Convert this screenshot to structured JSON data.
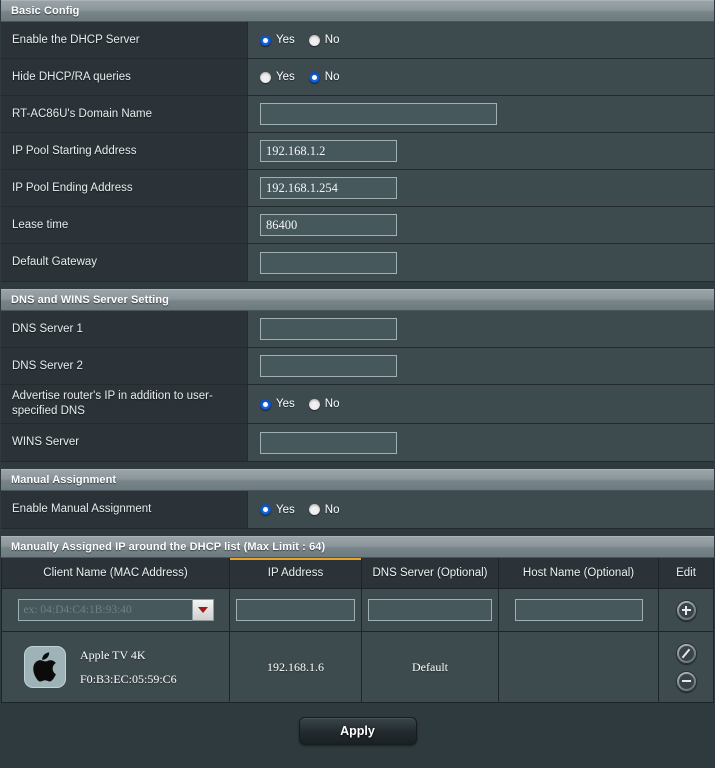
{
  "colors": {
    "accent": "#e7a52a",
    "radio_selected": "#1668e3",
    "panel_bg": "#3d4b4f",
    "label_bg": "#2b3338",
    "page_bg": "#2f3a3e"
  },
  "sections": {
    "basic": {
      "title": "Basic Config",
      "rows": {
        "dhcp_enable": {
          "label": "Enable the DHCP Server",
          "yes": "Yes",
          "no": "No",
          "selected": "Yes"
        },
        "hide_queries": {
          "label": "Hide DHCP/RA queries",
          "yes": "Yes",
          "no": "No",
          "selected": "No"
        },
        "domain_name": {
          "label": "RT-AC86U's Domain Name",
          "value": "",
          "placeholder": ""
        },
        "pool_start": {
          "label": "IP Pool Starting Address",
          "value": "192.168.1.2"
        },
        "pool_end": {
          "label": "IP Pool Ending Address",
          "value": "192.168.1.254"
        },
        "lease_time": {
          "label": "Lease time",
          "value": "86400"
        },
        "default_gateway": {
          "label": "Default Gateway",
          "value": ""
        }
      }
    },
    "dns": {
      "title": "DNS and WINS Server Setting",
      "rows": {
        "dns1": {
          "label": "DNS Server 1",
          "value": ""
        },
        "dns2": {
          "label": "DNS Server 2",
          "value": ""
        },
        "advertise": {
          "label": "Advertise router's IP in addition to user-specified DNS",
          "yes": "Yes",
          "no": "No",
          "selected": "Yes"
        },
        "wins": {
          "label": "WINS Server",
          "value": ""
        }
      }
    },
    "manual": {
      "title": "Manual Assignment",
      "rows": {
        "enable": {
          "label": "Enable Manual Assignment",
          "yes": "Yes",
          "no": "No",
          "selected": "Yes"
        }
      }
    },
    "list": {
      "title": "Manually Assigned IP around the DHCP list (Max Limit : 64)",
      "headers": {
        "client": "Client Name (MAC Address)",
        "ip": "IP Address",
        "dns": "DNS Server (Optional)",
        "host": "Host Name (Optional)",
        "edit": "Edit"
      },
      "new_entry": {
        "mac_placeholder": "ex: 04:D4:C4:1B:93:40",
        "mac_value": "",
        "ip_value": "",
        "dns_value": "",
        "host_value": ""
      },
      "entries": [
        {
          "icon": "apple-logo-icon",
          "name": "Apple TV 4K",
          "mac": "F0:B3:EC:05:59:C6",
          "ip": "192.168.1.6",
          "dns": "Default",
          "host": ""
        }
      ]
    }
  },
  "footer": {
    "apply_label": "Apply"
  }
}
